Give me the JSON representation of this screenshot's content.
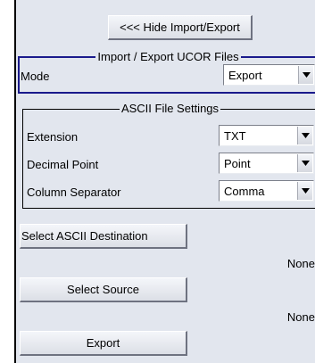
{
  "hide_button_label": "<<< Hide Import/Export",
  "ucor_group": {
    "title": "Import / Export UCOR Files",
    "mode_label": "Mode",
    "mode_value": "Export"
  },
  "ascii_group": {
    "title": "ASCII File Settings",
    "extension_label": "Extension",
    "extension_value": "TXT",
    "decimal_label": "Decimal Point",
    "decimal_value": "Point",
    "separator_label": "Column Separator",
    "separator_value": "Comma"
  },
  "destination": {
    "button_label": "Select ASCII Destination",
    "value": "None"
  },
  "source": {
    "button_label": "Select Source",
    "value": "None"
  },
  "export_button_label": "Export",
  "colors": {
    "panel_bg": "#e2e6ee",
    "selected_border": "#1a1a8c",
    "group_border": "#000000"
  }
}
